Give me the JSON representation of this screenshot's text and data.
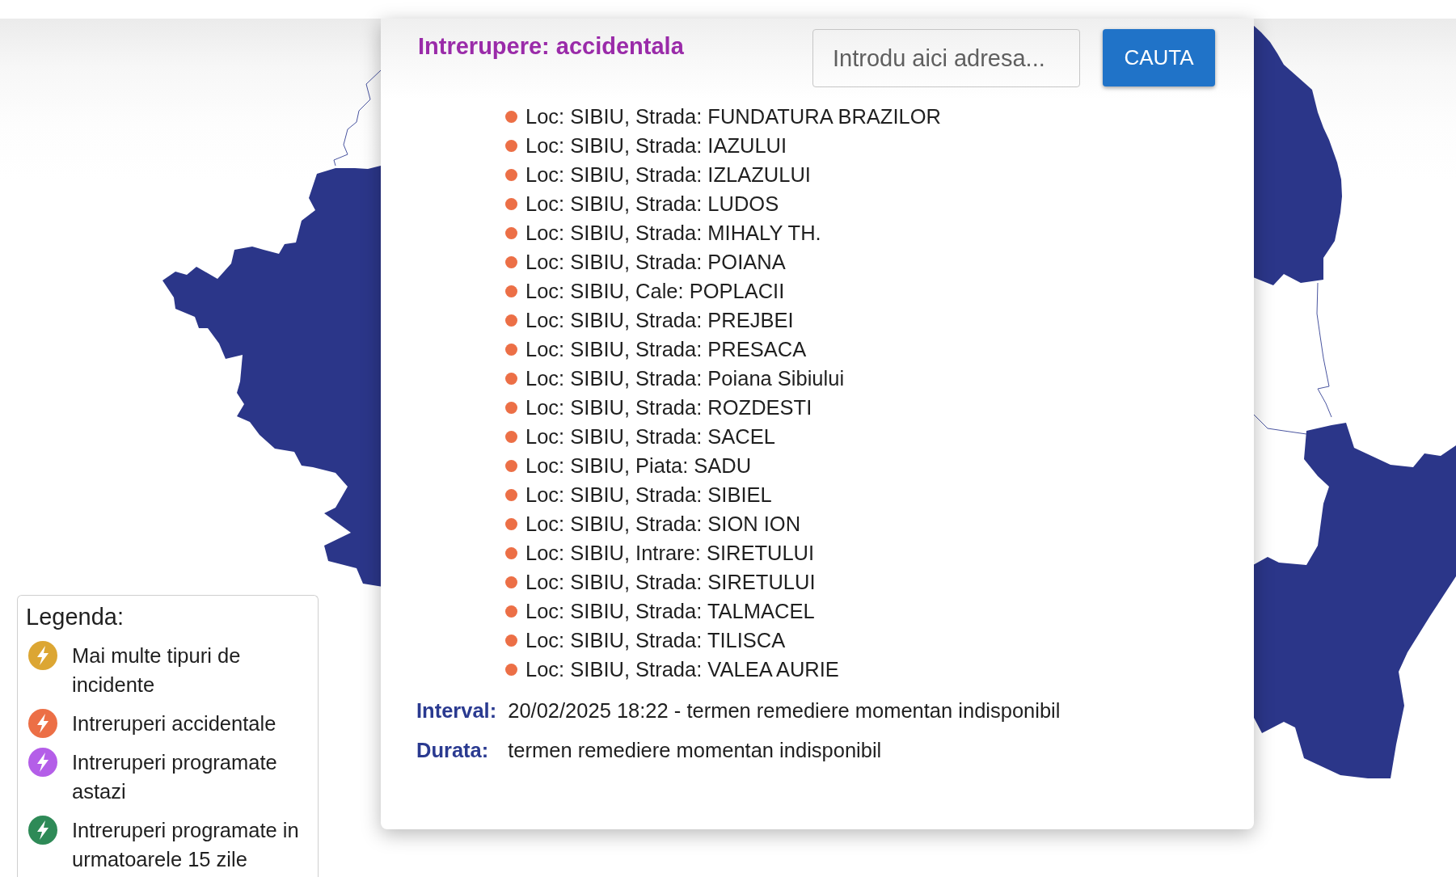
{
  "popup": {
    "title": "Intrerupere: accidentala",
    "search": {
      "placeholder": "Introdu aici adresa..."
    },
    "search_button": "CAUTA",
    "locations": [
      "Loc: SIBIU, Strada: FUNDATURA BRAZILOR",
      "Loc: SIBIU, Strada: IAZULUI",
      "Loc: SIBIU, Strada: IZLAZULUI",
      "Loc: SIBIU, Strada: LUDOS",
      "Loc: SIBIU, Strada: MIHALY TH.",
      "Loc: SIBIU, Strada: POIANA",
      "Loc: SIBIU, Cale: POPLACII",
      "Loc: SIBIU, Strada: PREJBEI",
      "Loc: SIBIU, Strada: PRESACA",
      "Loc: SIBIU, Strada: Poiana Sibiului",
      "Loc: SIBIU, Strada: ROZDESTI",
      "Loc: SIBIU, Strada: SACEL",
      "Loc: SIBIU, Piata: SADU",
      "Loc: SIBIU, Strada: SIBIEL",
      "Loc: SIBIU, Strada: SION ION",
      "Loc: SIBIU, Intrare: SIRETULUI",
      "Loc: SIBIU, Strada: SIRETULUI",
      "Loc: SIBIU, Strada: TALMACEL",
      "Loc: SIBIU, Strada: TILISCA",
      "Loc: SIBIU, Strada: VALEA AURIE"
    ],
    "details": [
      {
        "label": "Interval:",
        "value": "20/02/2025 18:22 - termen remediere momentan indisponibil"
      },
      {
        "label": "Durata:",
        "value": "termen remediere momentan indisponibil"
      }
    ]
  },
  "legend": {
    "title": "Legenda:",
    "items": [
      {
        "label": "Mai multe tipuri de incidente",
        "color": "#dca633"
      },
      {
        "label": "Intreruperi accidentale",
        "color": "#ec6f46"
      },
      {
        "label": "Intreruperi programate astazi",
        "color": "#b45ee8"
      },
      {
        "label": "Intreruperi programate in urmatoarele 15 zile",
        "color": "#2e8a57"
      }
    ]
  }
}
